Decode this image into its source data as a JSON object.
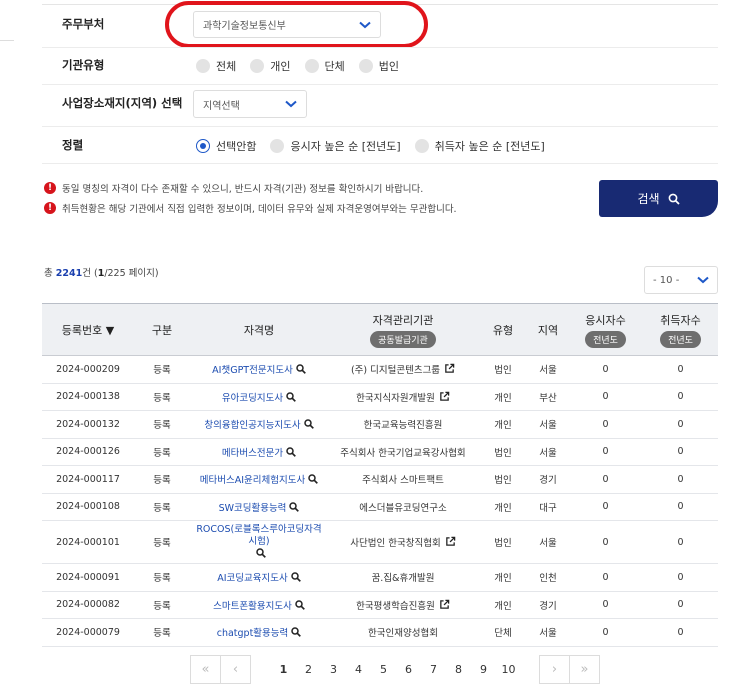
{
  "filters": {
    "agency": {
      "label": "주무부처",
      "value": "과학기술정보통신부"
    },
    "org_type": {
      "label": "기관유형",
      "options": [
        "전체",
        "개인",
        "단체",
        "법인"
      ]
    },
    "region": {
      "label": "사업장소재지(지역) 선택",
      "value": "지역선택"
    },
    "sort": {
      "label": "정렬",
      "options": [
        "선택안함",
        "응시자 높은 순 [전년도]",
        "취득자 높은 순 [전년도]"
      ],
      "selected": "선택안함"
    }
  },
  "notices": [
    "동일 명칭의 자격이 다수 존재할 수 있으니, 반드시 자격(기관) 정보를 확인하시기 바랍니다.",
    "취득현황은 해당 기관에서 직접 입력한 정보이며, 데이터 유무와 실제 자격운영여부와는 무관합니다."
  ],
  "search_button": "검색",
  "summary": {
    "prefix": "총 ",
    "count": "2241",
    "mid": "건 (",
    "page": "1",
    "suffix": "/225 페이지)"
  },
  "page_size": "- 10 -",
  "colors": {
    "navy": "#182a73",
    "link": "#1d4db0",
    "alert": "#d6141c"
  },
  "table": {
    "headers": {
      "reg_no": "등록번호 ▼",
      "category": "구분",
      "name": "자격명",
      "org": "자격관리기관",
      "org_badge": "공동발급기관",
      "type": "유형",
      "region": "지역",
      "applicants": "응시자수",
      "applicants_badge": "전년도",
      "acquirers": "취득자수",
      "acquirers_badge": "전년도"
    },
    "rows": [
      {
        "reg": "2024-000209",
        "cat": "등록",
        "name": "AI챗GPT전문지도사",
        "org": "(주) 디지털콘텐츠그룹",
        "ext": true,
        "type": "법인",
        "region": "서울",
        "app": "0",
        "acq": "0"
      },
      {
        "reg": "2024-000138",
        "cat": "등록",
        "name": "유아코딩지도사",
        "org": "한국지식자원개발원",
        "ext": true,
        "type": "개인",
        "region": "부산",
        "app": "0",
        "acq": "0"
      },
      {
        "reg": "2024-000132",
        "cat": "등록",
        "name": "창의융합인공지능지도사",
        "org": "한국교육능력진흥원",
        "ext": false,
        "type": "개인",
        "region": "서울",
        "app": "0",
        "acq": "0"
      },
      {
        "reg": "2024-000126",
        "cat": "등록",
        "name": "메타버스전문가",
        "org": "주식회사 한국기업교육강사협회",
        "ext": false,
        "type": "법인",
        "region": "서울",
        "app": "0",
        "acq": "0"
      },
      {
        "reg": "2024-000117",
        "cat": "등록",
        "name": "메타버스AI윤리체험지도사",
        "org": "주식회사 스마트팩트",
        "ext": false,
        "type": "법인",
        "region": "경기",
        "app": "0",
        "acq": "0"
      },
      {
        "reg": "2024-000108",
        "cat": "등록",
        "name": "SW코딩활용능력",
        "org": "에스더블유코딩연구소",
        "ext": false,
        "type": "개인",
        "region": "대구",
        "app": "0",
        "acq": "0"
      },
      {
        "reg": "2024-000101",
        "cat": "등록",
        "name": "ROCOS(로블록스루아코딩자격시험)",
        "org": "사단법인 한국창직협회",
        "ext": true,
        "type": "법인",
        "region": "서울",
        "app": "0",
        "acq": "0",
        "tall": true
      },
      {
        "reg": "2024-000091",
        "cat": "등록",
        "name": "AI코딩교육지도사",
        "org": "꿈.집&휴개발원",
        "ext": false,
        "type": "개인",
        "region": "인천",
        "app": "0",
        "acq": "0"
      },
      {
        "reg": "2024-000082",
        "cat": "등록",
        "name": "스마트폰활용지도사",
        "org": "한국평생학습진흥원",
        "ext": true,
        "type": "개인",
        "region": "경기",
        "app": "0",
        "acq": "0"
      },
      {
        "reg": "2024-000079",
        "cat": "등록",
        "name": "chatgpt활용능력",
        "org": "한국인재양성협회",
        "ext": false,
        "type": "단체",
        "region": "서울",
        "app": "0",
        "acq": "0"
      }
    ]
  },
  "pagination": {
    "first": "«",
    "prev": "‹",
    "pages": [
      "1",
      "2",
      "3",
      "4",
      "5",
      "6",
      "7",
      "8",
      "9",
      "10"
    ],
    "current": "1",
    "next": "›",
    "last": "»"
  }
}
